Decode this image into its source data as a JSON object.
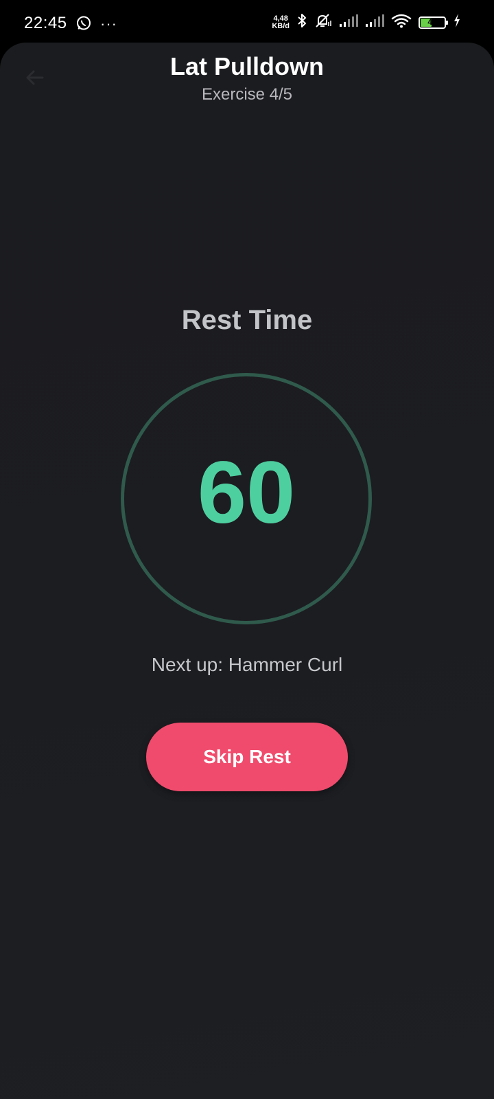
{
  "status_bar": {
    "time": "22:45",
    "notification_icon": "whatsapp-icon",
    "more": "···",
    "net_speed_value": "4,48",
    "net_speed_unit": "KB/d",
    "battery_level": "44",
    "icons": [
      "bluetooth-icon",
      "muted-alarm-icon",
      "signal-icon",
      "signal-icon",
      "wifi-icon",
      "battery-icon",
      "charging-icon"
    ]
  },
  "header": {
    "back_icon": "arrow-left-icon",
    "title": "Lat Pulldown",
    "subtitle": "Exercise 4/5"
  },
  "rest": {
    "label": "Rest Time",
    "seconds": "60",
    "next_up": "Next up: Hammer Curl",
    "skip_label": "Skip Rest"
  },
  "colors": {
    "accent_green": "#4ecfa0",
    "ring_green": "#2f5a4c",
    "skip_button": "#f04b6c",
    "background": "#1c1d21"
  }
}
